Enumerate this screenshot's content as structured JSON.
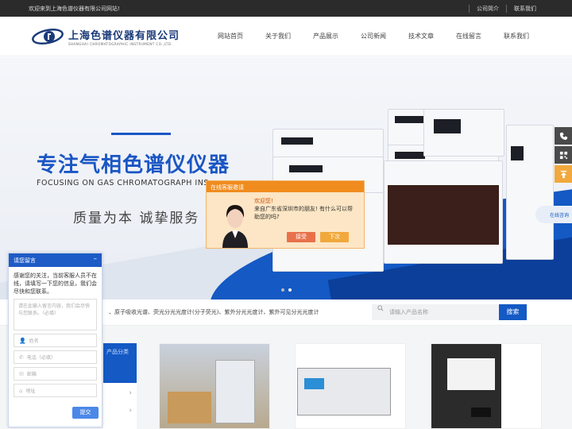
{
  "topbar": {
    "welcome": "欢迎来到上海色谱仪器有限公司网站!",
    "links": [
      "公司简介",
      "联系我们"
    ]
  },
  "header": {
    "logo_cn": "上海色谱仪器有限公司",
    "logo_en": "SHANGHAI CHROMATOGRAPHIC INSTRUMENT CO.,LTD.",
    "nav": [
      "网站首页",
      "关于我们",
      "产品展示",
      "公司新闻",
      "技术文章",
      "在线留言",
      "联系我们"
    ]
  },
  "banner": {
    "title": "专注气相色谱仪仪器",
    "subtitle_en": "FOCUSING ON GAS CHROMATOGRAPH INS",
    "slogan": "质量为本  诚挚服务",
    "active_dot": 2
  },
  "chat_popup": {
    "header": "在线客服邀请",
    "greeting": "欢迎您!",
    "message": "来自广东省深圳市的朋友! 有什么可以帮助您的吗?",
    "accept": "接受",
    "later": "下次"
  },
  "right_float": {
    "online_label": "在线咨询",
    "colors": {
      "phone": "#4a4a4a",
      "qr": "#4a4a4a",
      "top": "#f1a83c"
    }
  },
  "search": {
    "hot_keywords": "、原子吸收光谱、荧光分光光度计(分子荧光)、紫外分光光度计、紫外可见分光光度计",
    "placeholder": "请输入产品名称",
    "button": "搜索"
  },
  "products": {
    "category_label": "产品分类"
  },
  "message_panel": {
    "title": "请您留言",
    "intro": "感谢您的关注，当前客服人员不在线，请填写一下您的信息，我们会尽快和您联系。",
    "textarea_placeholder": "请在此输入留言内容，我们会尽快与您联系。（必填）",
    "fields": [
      {
        "icon": "user-icon",
        "placeholder": "姓名"
      },
      {
        "icon": "phone-icon",
        "placeholder": "电话（必填）"
      },
      {
        "icon": "mail-icon",
        "placeholder": "邮箱"
      },
      {
        "icon": "location-icon",
        "placeholder": "地址"
      }
    ],
    "submit": "提交"
  },
  "colors": {
    "brand_blue": "#1459c4",
    "topbar_bg": "#2b2b2b",
    "chat_orange": "#f08c1e"
  }
}
